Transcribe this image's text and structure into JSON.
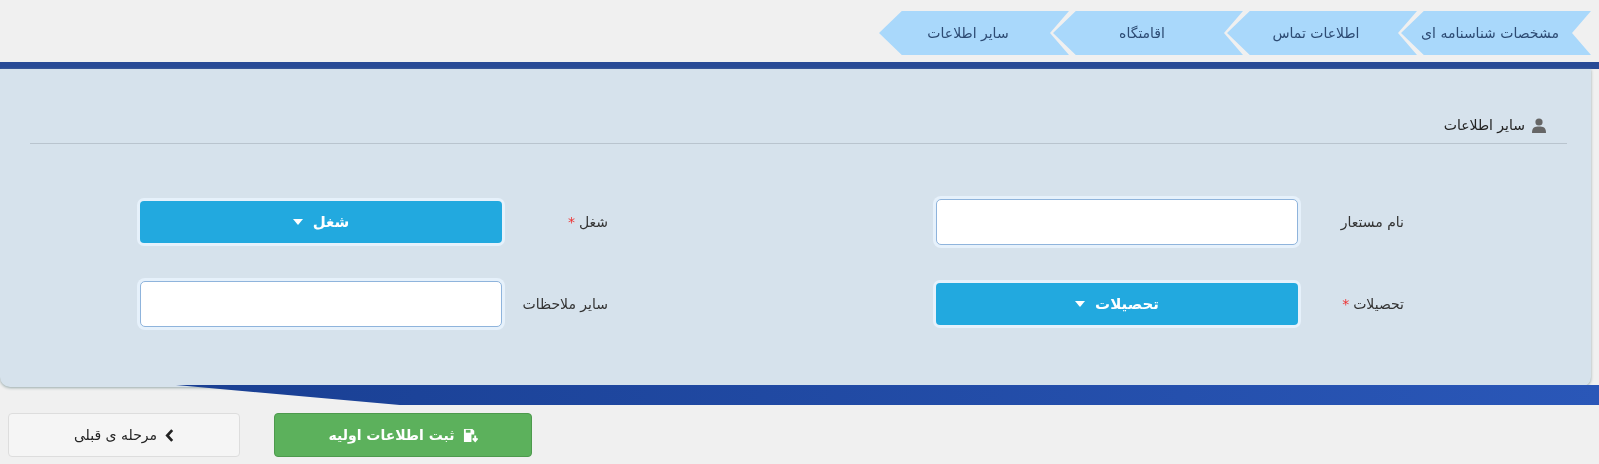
{
  "tabs": [
    {
      "label": "مشخصات شناسنامه ای",
      "selected": false
    },
    {
      "label": "اطلاعات تماس",
      "selected": false
    },
    {
      "label": "اقامتگاه",
      "selected": false
    },
    {
      "label": "سایر اطلاعات",
      "selected": false
    }
  ],
  "section": {
    "title": "سایر اطلاعات"
  },
  "fields": [
    {
      "kind": "text",
      "label": "نام مستعار",
      "required": false
    },
    {
      "kind": "select",
      "label": "شغل",
      "required": true,
      "value": "شغل"
    },
    {
      "kind": "select",
      "label": "تحصیلات",
      "required": true,
      "value": "تحصیلات"
    },
    {
      "kind": "text",
      "label": "سایر ملاحظات",
      "required": false
    }
  ],
  "required_mark": "*",
  "buttons": [
    {
      "kind": "submit",
      "label": "ثبت اطلاعات اولیه"
    },
    {
      "kind": "back",
      "label": "مرحله ی قبلی"
    }
  ]
}
